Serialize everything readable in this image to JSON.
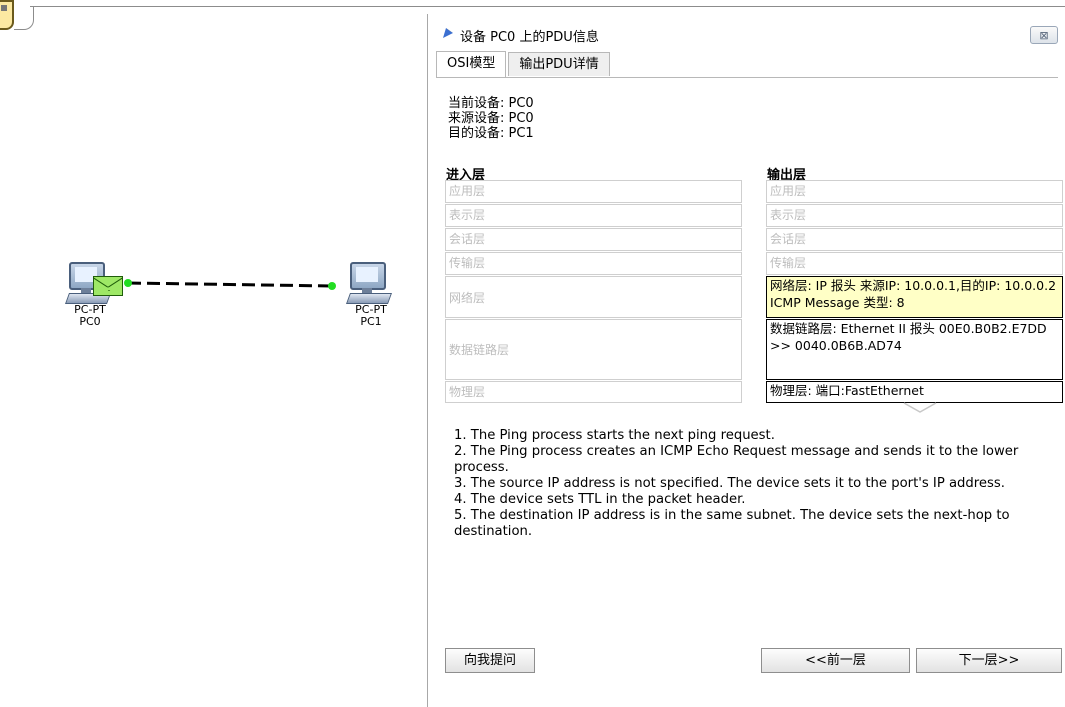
{
  "workspace": {
    "devices": [
      {
        "model": "PC-PT",
        "name": "PC0"
      },
      {
        "model": "PC-PT",
        "name": "PC1"
      }
    ],
    "link_color": "#000000",
    "port_light_color": "#22dd22"
  },
  "dialog": {
    "title": "设备 PC0 上的PDU信息",
    "close_glyph": "⊠",
    "tabs": [
      {
        "label": "OSI模型",
        "active": true
      },
      {
        "label": "输出PDU详情",
        "active": false
      }
    ],
    "device_info": {
      "current": "当前设备: PC0",
      "source": "来源设备: PC0",
      "destination": "目的设备: PC1"
    },
    "in_layers": {
      "header": "进入层",
      "items": [
        "应用层",
        "表示层",
        "会话层",
        "传输层",
        "网络层",
        "数据链路层",
        "物理层"
      ]
    },
    "out_layers": {
      "header": "输出层",
      "items": [
        "应用层",
        "表示层",
        "会话层",
        "传输层",
        "网络层: IP 报头 来源IP: 10.0.0.1,目的IP: 10.0.0.2 ICMP Message 类型: 8",
        "数据链路层: Ethernet II 报头 00E0.B0B2.E7DD >> 0040.0B6B.AD74",
        "物理层: 端口:FastEthernet"
      ],
      "highlight_color": "#ffffc6"
    },
    "steps": [
      "1. The Ping process starts the next ping request.",
      "2. The Ping process creates an ICMP Echo Request message and sends it to the lower process.",
      "3. The source IP address is not specified. The device sets it to the port's IP address.",
      "4. The device sets TTL in the packet header.",
      "5. The destination IP address is in the same subnet. The device sets the next-hop to destination."
    ],
    "buttons": {
      "ask": "向我提问",
      "prev": "<<前一层",
      "next": "下一层>>"
    }
  }
}
